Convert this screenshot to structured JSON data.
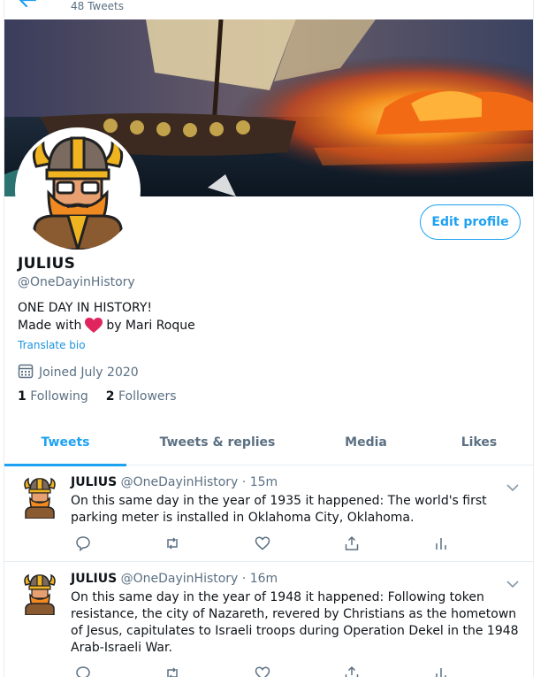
{
  "header": {
    "tweet_count": "48 Tweets"
  },
  "profile": {
    "name": "JULIUS",
    "handle": "@OneDayinHistory",
    "bio_line1": "ONE DAY IN HISTORY!",
    "bio_made_with": "Made with",
    "bio_by": "by Mari Roque",
    "translate_bio": "Translate bio",
    "joined": "Joined July 2020",
    "following_count": "1",
    "following_label": "Following",
    "followers_count": "2",
    "followers_label": "Followers",
    "edit_profile": "Edit profile"
  },
  "tabs": [
    {
      "label": "Tweets"
    },
    {
      "label": "Tweets & replies"
    },
    {
      "label": "Media"
    },
    {
      "label": "Likes"
    }
  ],
  "tweets": [
    {
      "name": "JULIUS",
      "handle": "@OneDayinHistory",
      "sep": "·",
      "time": "15m",
      "text": "On this same day in the year of 1935 it happened:  The world's first parking meter is installed in Oklahoma City, Oklahoma."
    },
    {
      "name": "JULIUS",
      "handle": "@OneDayinHistory",
      "sep": "·",
      "time": "16m",
      "text": "On this same day in the year of 1948 it happened:  Following token resistance, the city of Nazareth, revered by Christians as the hometown of Jesus, capitulates to Israeli troops during Operation Dekel in the 1948 Arab-Israeli War."
    }
  ],
  "colors": {
    "accent": "#1da1f2",
    "heart": "#e0245e",
    "secondary_text": "#5b7083"
  }
}
